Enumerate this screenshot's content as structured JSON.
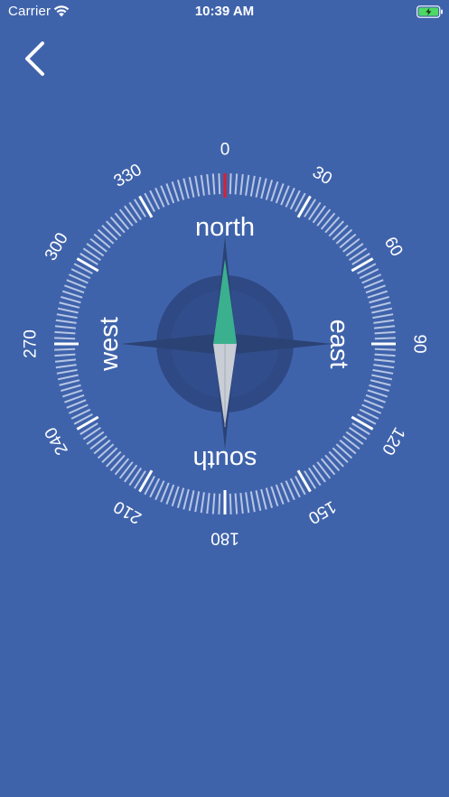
{
  "status_bar": {
    "carrier": "Carrier",
    "time": "10:39 AM",
    "wifi_icon": "wifi-icon",
    "battery_icon": "battery-charging-icon"
  },
  "nav": {
    "back_icon": "chevron-left-icon"
  },
  "compass": {
    "heading_degrees": 0,
    "degree_labels": [
      "0",
      "30",
      "60",
      "90",
      "120",
      "150",
      "180",
      "210",
      "240",
      "270",
      "300",
      "330"
    ],
    "cardinals": {
      "north": "north",
      "east": "east",
      "south": "south",
      "west": "west"
    },
    "colors": {
      "background": "#3f63ab",
      "heading_marker": "#d0243a",
      "needle_north": "#3bb08e",
      "needle_south": "#c8cdd6",
      "rose_dark": "#2b4275"
    }
  }
}
